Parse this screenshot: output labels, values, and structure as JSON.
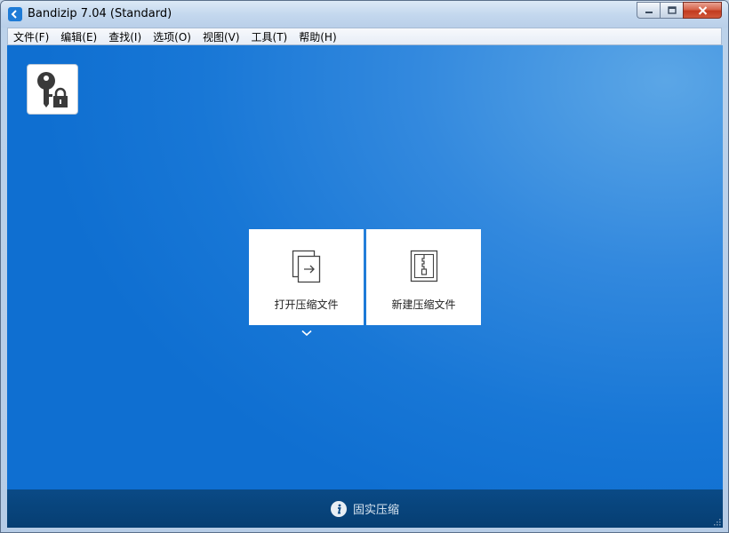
{
  "window": {
    "title": "Bandizip 7.04 (Standard)",
    "app_icon": "bandizip-icon"
  },
  "title_buttons": {
    "minimize": "minimize-icon",
    "maximize": "maximize-icon",
    "close": "close-icon"
  },
  "menu": [
    {
      "label": "文件(F)"
    },
    {
      "label": "编辑(E)"
    },
    {
      "label": "查找(I)"
    },
    {
      "label": "选项(O)"
    },
    {
      "label": "视图(V)"
    },
    {
      "label": "工具(T)"
    },
    {
      "label": "帮助(H)"
    }
  ],
  "main": {
    "key_tile_icon": "key-lock-icon",
    "open_archive": {
      "label": "打开压缩文件",
      "icon": "open-archive-icon"
    },
    "new_archive": {
      "label": "新建压缩文件",
      "icon": "new-archive-icon"
    },
    "more_icon": "chevron-down-icon"
  },
  "status": {
    "icon": "info-icon",
    "text": "固实压缩"
  },
  "colors": {
    "background_blue": "#1877d6",
    "statusbar": "#063e72",
    "tile": "#ffffff"
  }
}
